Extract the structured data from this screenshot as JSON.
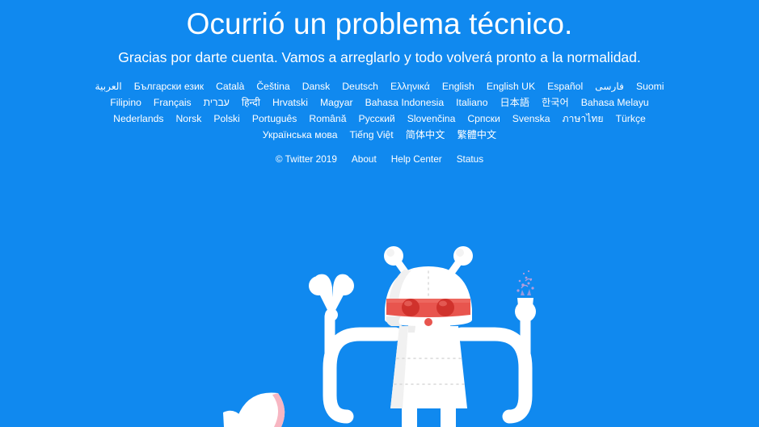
{
  "page": {
    "title": "Ocurrió un problema técnico.",
    "subtitle": "Gracias por darte cuenta. Vamos a arreglarlo y todo volverá pronto a la normalidad.",
    "background_color": "#1089ef",
    "text_color": "#ffffff",
    "accent_red": "#e8554e",
    "accent_red_dark": "#d0322c",
    "illustration_white": "#ffffff",
    "spark_color": "#b39ddb",
    "shell_pink": "#f7b6c2"
  },
  "languages": {
    "rows": [
      [
        {
          "label": "العربية"
        },
        {
          "label": "Български език"
        },
        {
          "label": "Català"
        },
        {
          "label": "Čeština"
        },
        {
          "label": "Dansk"
        },
        {
          "label": "Deutsch"
        },
        {
          "label": "Ελληνικά"
        },
        {
          "label": "English"
        },
        {
          "label": "English UK"
        },
        {
          "label": "Español"
        },
        {
          "label": "فارسی"
        },
        {
          "label": "Suomi"
        }
      ],
      [
        {
          "label": "Filipino"
        },
        {
          "label": "Français"
        },
        {
          "label": "עברית"
        },
        {
          "label": "हिन्दी"
        },
        {
          "label": "Hrvatski"
        },
        {
          "label": "Magyar"
        },
        {
          "label": "Bahasa Indonesia"
        },
        {
          "label": "Italiano"
        },
        {
          "label": "日本語"
        },
        {
          "label": "한국어"
        },
        {
          "label": "Bahasa Melayu"
        }
      ],
      [
        {
          "label": "Nederlands"
        },
        {
          "label": "Norsk"
        },
        {
          "label": "Polski"
        },
        {
          "label": "Português"
        },
        {
          "label": "Română"
        },
        {
          "label": "Русский"
        },
        {
          "label": "Slovenčina"
        },
        {
          "label": "Српски"
        },
        {
          "label": "Svenska"
        },
        {
          "label": "ภาษาไทย"
        },
        {
          "label": "Türkçe"
        }
      ],
      [
        {
          "label": "Українська мова"
        },
        {
          "label": "Tiếng Việt"
        },
        {
          "label": "简体中文"
        },
        {
          "label": "繁體中文"
        }
      ]
    ]
  },
  "footer": {
    "copyright": "© Twitter 2019",
    "links": [
      {
        "label": "About"
      },
      {
        "label": "Help Center"
      },
      {
        "label": "Status"
      }
    ]
  }
}
